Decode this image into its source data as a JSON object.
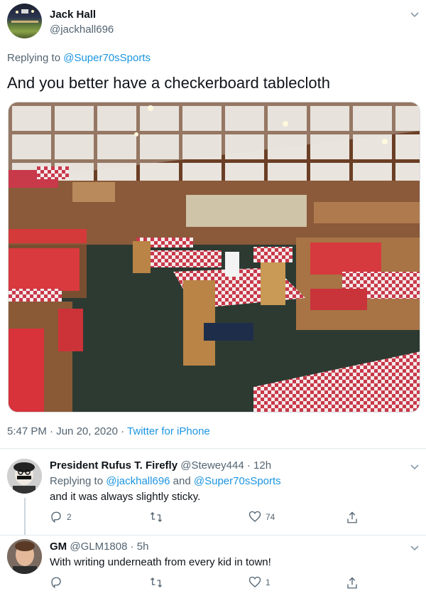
{
  "main_tweet": {
    "author_name": "Jack Hall",
    "handle": "@jackhall696",
    "replying_label": "Replying to",
    "replying_to": "@Super70sSports",
    "text": "And you better have a checkerboard tablecloth",
    "time": "5:47 PM",
    "date": "Jun 20, 2020",
    "separator": "·",
    "source": "Twitter for iPhone",
    "photo_desc_icon": "restaurant-photo"
  },
  "replies": [
    {
      "author_name": "President Rufus T. Firefly",
      "handle": "@Stewey444",
      "age": "12h",
      "replying_label": "Replying to",
      "replying_to_1": "@jackhall696",
      "and": "and",
      "replying_to_2": "@Super70sSports",
      "text": "and it was always slightly sticky.",
      "reply_count": "2",
      "retweet_count": "",
      "like_count": "74"
    },
    {
      "author_name": "GM",
      "handle": "@GLM1808",
      "age": "5h",
      "text": "With writing underneath from every kid in town!",
      "reply_count": "",
      "retweet_count": "",
      "like_count": "1"
    }
  ],
  "colors": {
    "link": "#1b95e0",
    "muted": "#536471",
    "text": "#0f1419"
  }
}
